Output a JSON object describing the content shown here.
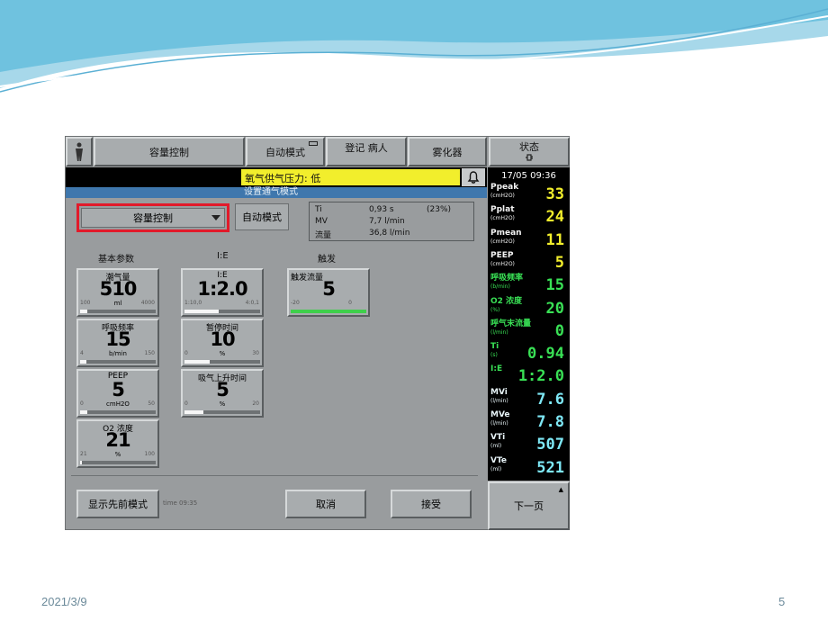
{
  "slide": {
    "date": "2021/3/9",
    "page_number": "5"
  },
  "topbar": {
    "mode": "容量控制",
    "auto_mode": "自动模式",
    "patient": "登记 病人",
    "nebulizer": "雾化器",
    "status": "状态",
    "status_icon": "plug-icon"
  },
  "alarm": {
    "message": "氧气供气压力: 低"
  },
  "dialog": {
    "title": "设置通气模式",
    "mode_select": "容量控制",
    "auto_button": "自动模式",
    "info": [
      {
        "name": "Ti",
        "value": "0,93 s",
        "extra": "(23%)"
      },
      {
        "name": "MV",
        "value": "7,7 l/min",
        "extra": ""
      },
      {
        "name": "流量",
        "value": "36,8 l/min",
        "extra": ""
      }
    ],
    "section_basic": "基本参数",
    "section_ie": "I:E",
    "section_trigger": "触发",
    "knobs": {
      "tidal": {
        "label": "潮气量",
        "value": "510",
        "unit": "ml",
        "min": "100",
        "max": "4000",
        "fill": 0.1
      },
      "ie": {
        "label": "I:E",
        "value": "1:2.0",
        "unit": "",
        "min": "1:10,0",
        "max": "4:0,1",
        "fill": 0.45
      },
      "trigger": {
        "label": "触发流量",
        "value": "5",
        "unit": "",
        "min": "-20",
        "max": "0",
        "fill": 1.0
      },
      "rr": {
        "label": "呼吸频率",
        "value": "15",
        "unit": "b/min",
        "min": "4",
        "max": "150",
        "fill": 0.08
      },
      "pause": {
        "label": "暂停时间",
        "value": "10",
        "unit": "%",
        "min": "0",
        "max": "30",
        "fill": 0.33
      },
      "peep": {
        "label": "PEEP",
        "value": "5",
        "unit": "cmH2O",
        "min": "0",
        "max": "50",
        "fill": 0.1
      },
      "rise": {
        "label": "吸气上升时间",
        "value": "5",
        "unit": "%",
        "min": "0",
        "max": "20",
        "fill": 0.25
      },
      "o2": {
        "label": "O2 浓度",
        "value": "21",
        "unit": "%",
        "min": "21",
        "max": "100",
        "fill": 0.02
      }
    },
    "show_prev": "显示先前模式",
    "time_label": "time 09:35",
    "cancel": "取消",
    "accept": "接受"
  },
  "monitor": {
    "datetime": "17/05   09:36",
    "rows": [
      {
        "label": "Ppeak",
        "unit": "(cmH2O)",
        "value": "33",
        "color": "yellow"
      },
      {
        "label": "Pplat",
        "unit": "(cmH2O)",
        "value": "24",
        "color": "yellow"
      },
      {
        "label": "Pmean",
        "unit": "(cmH2O)",
        "value": "11",
        "color": "yellow"
      },
      {
        "label": "PEEP",
        "unit": "(cmH2O)",
        "value": "5",
        "color": "yellow"
      },
      {
        "label": "呼吸频率",
        "unit": "(b/min)",
        "value": "15",
        "color": "green"
      },
      {
        "label": "O2 浓度",
        "unit": "(%)",
        "value": "20",
        "color": "green"
      },
      {
        "label": "呼气末流量",
        "unit": "(l/min)",
        "value": "0",
        "color": "green"
      },
      {
        "label": "Ti",
        "unit": "(s)",
        "value": "0.94",
        "color": "green"
      },
      {
        "label": "I:E",
        "unit": "",
        "value": "1:2.0",
        "color": "green"
      },
      {
        "label": "MVi",
        "unit": "(l/min)",
        "value": "7.6",
        "color": "cyan"
      },
      {
        "label": "MVe",
        "unit": "(l/min)",
        "value": "7.8",
        "color": "cyan"
      },
      {
        "label": "VTi",
        "unit": "(ml)",
        "value": "507",
        "color": "cyan"
      },
      {
        "label": "VTe",
        "unit": "(ml)",
        "value": "521",
        "color": "cyan"
      }
    ],
    "next_page": "下一页"
  }
}
